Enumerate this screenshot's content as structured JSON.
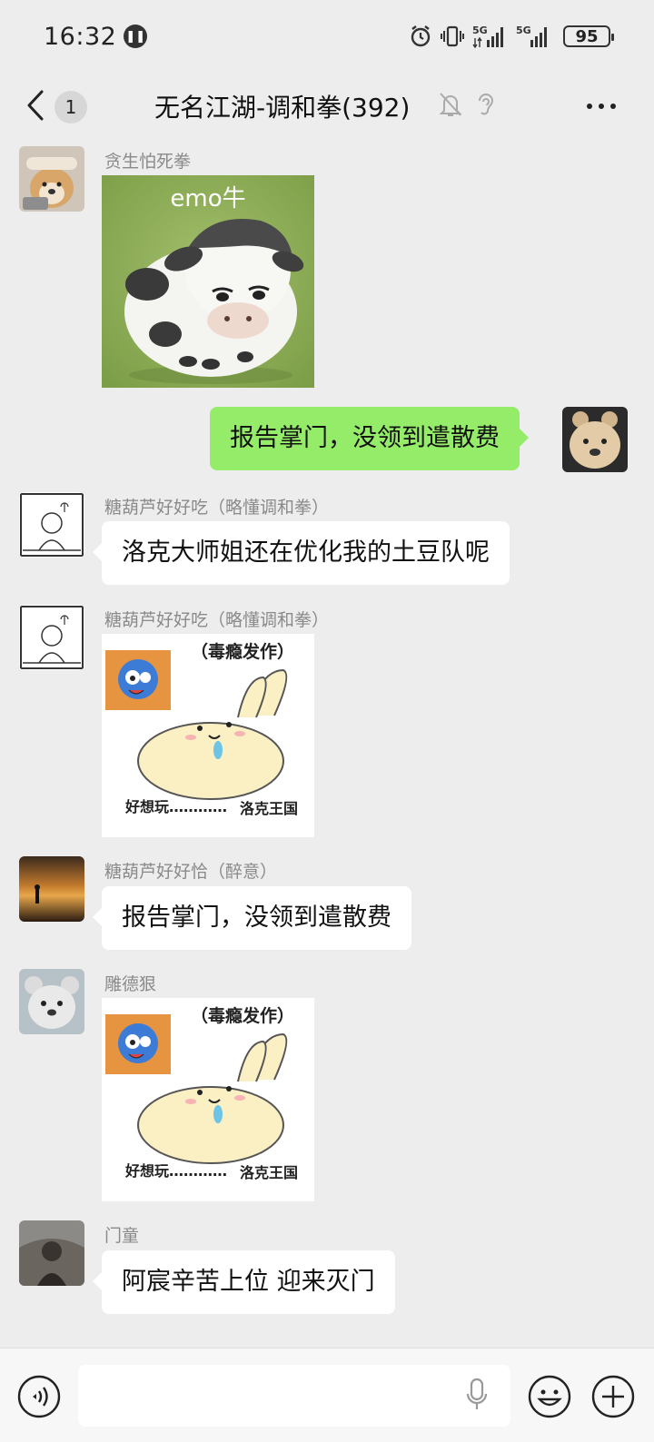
{
  "status_bar": {
    "time": "16:32",
    "network_1": "5G",
    "network_2": "5G",
    "battery": "95"
  },
  "header": {
    "back_badge": "1",
    "title": "无名江湖-调和拳(392)"
  },
  "messages": [
    {
      "sender": "贪生怕死拳",
      "type": "sticker",
      "sticker_text": "emo牛"
    },
    {
      "sender": "",
      "type": "text",
      "side": "right",
      "text": "报告掌门，没领到遣散费"
    },
    {
      "sender": "糖葫芦好好吃（略懂调和拳）",
      "type": "text",
      "text": "洛克大师姐还在优化我的土豆队呢"
    },
    {
      "sender": "糖葫芦好好吃（略懂调和拳）",
      "type": "sticker",
      "sticker_top": "（毒瘾发作）",
      "sticker_bottom_left": "好想玩…………",
      "sticker_bottom_right": "洛克王国"
    },
    {
      "sender": "糖葫芦好好恰（醉意）",
      "type": "text",
      "text": "报告掌门，没领到遣散费"
    },
    {
      "sender": "雕德狠",
      "type": "sticker",
      "sticker_top": "（毒瘾发作）",
      "sticker_bottom_left": "好想玩…………",
      "sticker_bottom_right": "洛克王国"
    },
    {
      "sender": "门童",
      "type": "text",
      "text": "阿宸辛苦上位 迎来灭门"
    }
  ],
  "input": {
    "placeholder": ""
  },
  "colors": {
    "background": "#ededed",
    "self_bubble": "#95ec69",
    "other_bubble": "#ffffff",
    "sender_name": "#8a8a8a"
  }
}
